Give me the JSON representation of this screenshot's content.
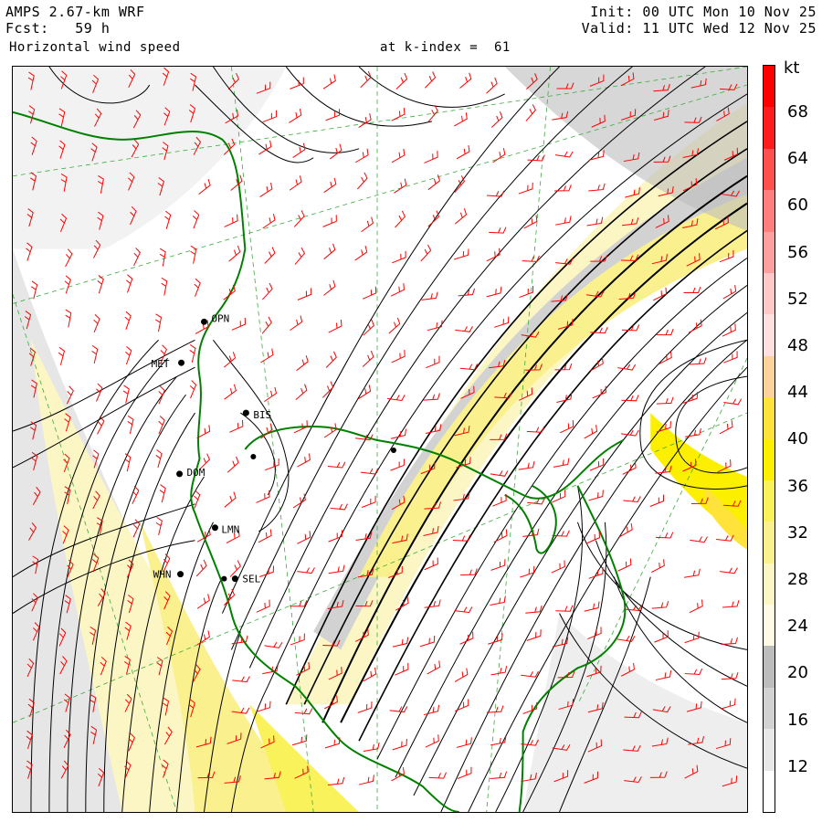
{
  "header": {
    "model": "AMPS 2.67-km WRF",
    "forecast": "Fcst:   59 h",
    "field": "Horizontal wind speed",
    "level": "at k-index =  61",
    "init": "Init: 00 UTC Mon 10 Nov 25",
    "valid": "Valid: 11 UTC Wed 12 Nov 25"
  },
  "colorbar": {
    "unit": "kt",
    "ticks": [
      "68",
      "64",
      "60",
      "56",
      "52",
      "48",
      "44",
      "40",
      "36",
      "32",
      "28",
      "24",
      "20",
      "16",
      "12"
    ],
    "colors": [
      "#ffffff",
      "#e8e8e8",
      "#d2d2d2",
      "#bdbdbd",
      "#fdfbe3",
      "#fbf6c4",
      "#faf08e",
      "#faf25a",
      "#fcf000",
      "#ffe23a",
      "#fcd39a",
      "#ffe0e0",
      "#ffc9c9",
      "#ffa0a0",
      "#ff7f7f",
      "#ff5050",
      "#ff1c1c",
      "#ff0000"
    ],
    "accent_coast": "#008000",
    "accent_barbs": "#ff0000",
    "accent_grid": "#3caa3c"
  },
  "stations": [
    {
      "id": "OPN"
    },
    {
      "id": "MET"
    },
    {
      "id": "BIS"
    },
    {
      "id": "DOM"
    },
    {
      "id": "LMN"
    },
    {
      "id": "WHN"
    },
    {
      "id": "SEL"
    }
  ]
}
